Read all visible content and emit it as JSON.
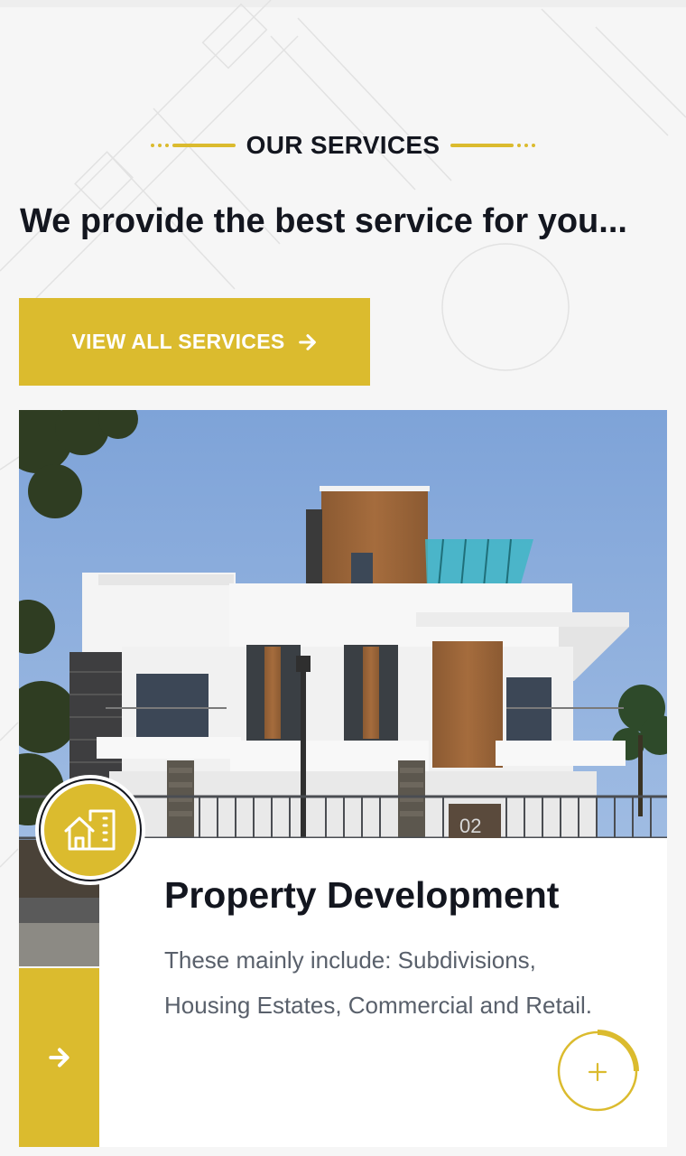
{
  "section": {
    "eyebrow": "OUR SERVICES",
    "heading": "We provide the best service for you...",
    "view_all_label": "VIEW ALL SERVICES"
  },
  "service_card": {
    "title": "Property Development",
    "description": "These mainly include: Subdivisions, Housing Estates, Commercial and Retail.",
    "badge_icon": "buildings-icon",
    "side_button_icon": "arrow-right-icon",
    "corner_button_icon": "plus-icon",
    "house_number": "02"
  },
  "colors": {
    "accent": "#dbbb2e",
    "heading": "#13161f",
    "body_text": "#59606b",
    "background": "#f6f6f6"
  }
}
